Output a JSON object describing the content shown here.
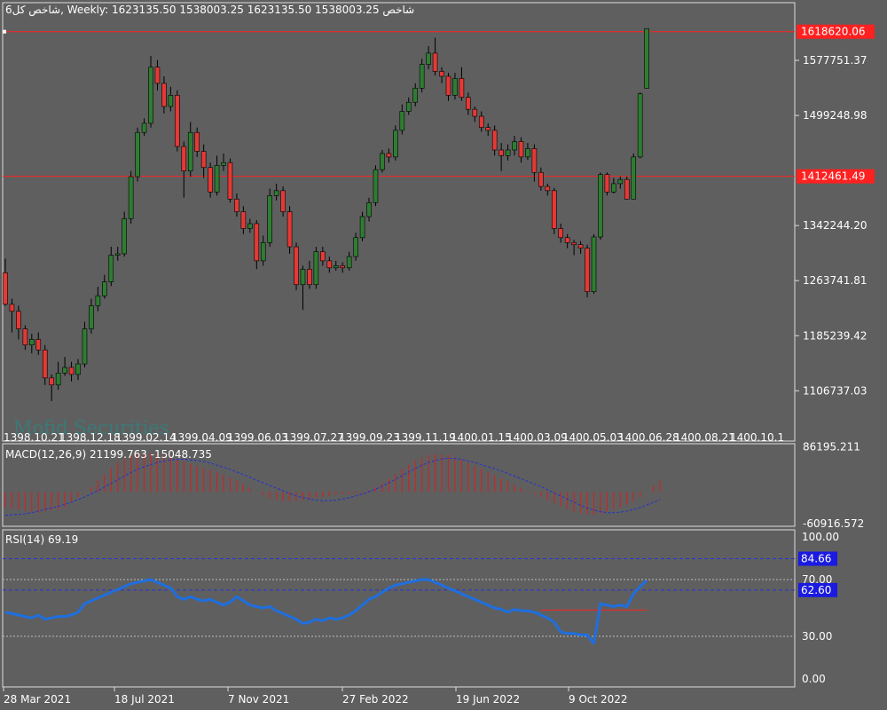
{
  "header": {
    "main": "6شاخص کل, Weekly:  1623135.50 1538003.25 1623135.50 1538003.25  شاخص",
    "macd": "MACD(12,26,9) 21199.763 -15048.735",
    "rsi": "RSI(14) 69.19"
  },
  "watermark": "Mofid Securities",
  "colors": {
    "bg": "#5f5f5f",
    "bull": "#2e7d32",
    "bear": "#e53935",
    "grid": "#9a9a9a",
    "hline": "#ff2020",
    "rsi": "#1e6fe0",
    "signal": "#2233cc",
    "label_bg": "#1a1ae0"
  },
  "chart_data": [
    {
      "type": "candlestick",
      "title": "شاخص کل",
      "timeframe": "Weekly",
      "y_ticks": [
        "1577751.37",
        "1499248.98",
        "1342244.20",
        "1263741.81",
        "1185239.42",
        "1106737.03"
      ],
      "ylim": [
        1035000,
        1660000
      ],
      "price_labels": [
        "1618620.06",
        "1412461.49"
      ],
      "hlines": [
        1618620.06,
        1412461.49
      ],
      "top_date_labels": [
        "1398.10.21",
        "1398.12.18",
        "1399.02.14",
        "1399.04.09",
        "1399.06.03",
        "1399.07.27",
        "1399.09.23",
        "1399.11.19",
        "1400.01.15",
        "1400.03.09",
        "1400.05.03",
        "1400.06.28",
        "1400.08.21",
        "1400.10.1"
      ],
      "x_labels": [
        "28 Mar 2021",
        "18 Jul 2021",
        "7 Nov 2021",
        "27 Feb 2022",
        "19 Jun 2022",
        "9 Oct 2022"
      ],
      "candles": [
        [
          1275000,
          1230000,
          1295000,
          1228000
        ],
        [
          1230000,
          1220000,
          1238000,
          1190000
        ],
        [
          1220000,
          1195000,
          1228000,
          1180000
        ],
        [
          1195000,
          1172000,
          1200000,
          1165000
        ],
        [
          1172000,
          1180000,
          1188000,
          1160000
        ],
        [
          1180000,
          1165000,
          1190000,
          1158000
        ],
        [
          1165000,
          1125000,
          1172000,
          1115000
        ],
        [
          1125000,
          1115000,
          1130000,
          1092000
        ],
        [
          1115000,
          1132000,
          1148000,
          1108000
        ],
        [
          1132000,
          1140000,
          1155000,
          1128000
        ],
        [
          1140000,
          1130000,
          1148000,
          1120000
        ],
        [
          1130000,
          1145000,
          1152000,
          1122000
        ],
        [
          1145000,
          1195000,
          1205000,
          1140000
        ],
        [
          1195000,
          1228000,
          1238000,
          1188000
        ],
        [
          1228000,
          1242000,
          1255000,
          1220000
        ],
        [
          1242000,
          1262000,
          1272000,
          1238000
        ],
        [
          1262000,
          1300000,
          1312000,
          1256000
        ],
        [
          1300000,
          1302000,
          1312000,
          1292000
        ],
        [
          1302000,
          1352000,
          1362000,
          1298000
        ],
        [
          1352000,
          1412000,
          1420000,
          1345000
        ],
        [
          1412000,
          1475000,
          1482000,
          1405000
        ],
        [
          1475000,
          1488000,
          1495000,
          1470000
        ],
        [
          1488000,
          1568000,
          1584000,
          1482000
        ],
        [
          1568000,
          1545000,
          1578000,
          1535000
        ],
        [
          1545000,
          1512000,
          1555000,
          1502000
        ],
        [
          1512000,
          1528000,
          1540000,
          1505000
        ],
        [
          1528000,
          1455000,
          1535000,
          1448000
        ],
        [
          1455000,
          1420000,
          1462000,
          1382000
        ],
        [
          1420000,
          1475000,
          1490000,
          1412000
        ],
        [
          1475000,
          1448000,
          1482000,
          1440000
        ],
        [
          1448000,
          1425000,
          1458000,
          1410000
        ],
        [
          1425000,
          1390000,
          1432000,
          1382000
        ],
        [
          1390000,
          1428000,
          1442000,
          1385000
        ],
        [
          1428000,
          1432000,
          1445000,
          1420000
        ],
        [
          1432000,
          1380000,
          1438000,
          1375000
        ],
        [
          1380000,
          1362000,
          1388000,
          1355000
        ],
        [
          1362000,
          1338000,
          1370000,
          1330000
        ],
        [
          1338000,
          1345000,
          1352000,
          1332000
        ],
        [
          1345000,
          1292000,
          1350000,
          1280000
        ],
        [
          1292000,
          1318000,
          1328000,
          1285000
        ],
        [
          1318000,
          1385000,
          1395000,
          1312000
        ],
        [
          1385000,
          1392000,
          1402000,
          1378000
        ],
        [
          1392000,
          1362000,
          1398000,
          1355000
        ],
        [
          1362000,
          1312000,
          1370000,
          1302000
        ],
        [
          1312000,
          1258000,
          1318000,
          1250000
        ],
        [
          1258000,
          1280000,
          1285000,
          1222000
        ],
        [
          1280000,
          1258000,
          1292000,
          1252000
        ],
        [
          1258000,
          1305000,
          1312000,
          1252000
        ],
        [
          1305000,
          1292000,
          1312000,
          1285000
        ],
        [
          1292000,
          1282000,
          1298000,
          1275000
        ],
        [
          1282000,
          1285000,
          1292000,
          1278000
        ],
        [
          1285000,
          1282000,
          1290000,
          1275000
        ],
        [
          1282000,
          1298000,
          1305000,
          1278000
        ],
        [
          1298000,
          1325000,
          1332000,
          1292000
        ],
        [
          1325000,
          1355000,
          1362000,
          1320000
        ],
        [
          1355000,
          1375000,
          1382000,
          1348000
        ],
        [
          1375000,
          1422000,
          1428000,
          1370000
        ],
        [
          1422000,
          1445000,
          1450000,
          1418000
        ],
        [
          1445000,
          1440000,
          1452000,
          1432000
        ],
        [
          1440000,
          1478000,
          1485000,
          1435000
        ],
        [
          1478000,
          1505000,
          1515000,
          1472000
        ],
        [
          1505000,
          1518000,
          1525000,
          1500000
        ],
        [
          1518000,
          1538000,
          1545000,
          1512000
        ],
        [
          1538000,
          1572000,
          1580000,
          1532000
        ],
        [
          1572000,
          1588000,
          1598000,
          1565000
        ],
        [
          1588000,
          1562000,
          1610000,
          1556000
        ],
        [
          1562000,
          1555000,
          1568000,
          1545000
        ],
        [
          1555000,
          1528000,
          1560000,
          1520000
        ],
        [
          1528000,
          1552000,
          1560000,
          1522000
        ],
        [
          1552000,
          1525000,
          1568000,
          1520000
        ],
        [
          1525000,
          1508000,
          1532000,
          1500000
        ],
        [
          1508000,
          1498000,
          1512000,
          1490000
        ],
        [
          1498000,
          1482000,
          1505000,
          1476000
        ],
        [
          1482000,
          1478000,
          1488000,
          1470000
        ],
        [
          1478000,
          1450000,
          1485000,
          1442000
        ],
        [
          1450000,
          1442000,
          1460000,
          1420000
        ],
        [
          1442000,
          1450000,
          1458000,
          1435000
        ],
        [
          1450000,
          1462000,
          1470000,
          1442000
        ],
        [
          1462000,
          1440000,
          1468000,
          1432000
        ],
        [
          1440000,
          1452000,
          1460000,
          1436000
        ],
        [
          1452000,
          1418000,
          1458000,
          1405000
        ],
        [
          1418000,
          1398000,
          1425000,
          1392000
        ],
        [
          1398000,
          1392000,
          1402000,
          1385000
        ],
        [
          1392000,
          1338000,
          1396000,
          1330000
        ],
        [
          1338000,
          1325000,
          1345000,
          1318000
        ],
        [
          1325000,
          1318000,
          1330000,
          1310000
        ],
        [
          1318000,
          1315000,
          1322000,
          1300000
        ],
        [
          1315000,
          1310000,
          1320000,
          1302000
        ],
        [
          1310000,
          1248000,
          1315000,
          1240000
        ],
        [
          1248000,
          1326000,
          1330000,
          1245000
        ],
        [
          1326000,
          1415000,
          1418000,
          1322000
        ],
        [
          1415000,
          1390000,
          1418000,
          1385000
        ],
        [
          1390000,
          1402000,
          1410000,
          1388000
        ],
        [
          1402000,
          1408000,
          1412000,
          1395000
        ],
        [
          1408000,
          1380000,
          1412000,
          1380000
        ],
        [
          1380000,
          1440000,
          1445000,
          1380000
        ],
        [
          1440000,
          1530000,
          1532000,
          1438000
        ],
        [
          1538000,
          1623000,
          1623000,
          1538000
        ]
      ]
    },
    {
      "type": "bar",
      "name": "MACD(12,26,9)",
      "values_shown": [
        21199.763,
        -15048.735
      ],
      "y_ticks": [
        "86195.211",
        "-60916.572"
      ],
      "ylim": [
        -66000,
        92000
      ],
      "histogram": [
        -30000,
        -32000,
        -34000,
        -36000,
        -38000,
        -40000,
        -38000,
        -36000,
        -34000,
        -30000,
        -20000,
        -10000,
        0,
        10000,
        22000,
        34000,
        46000,
        56000,
        64000,
        70000,
        72000,
        74000,
        74000,
        72000,
        70000,
        66000,
        62000,
        58000,
        54000,
        50000,
        46000,
        42000,
        38000,
        33000,
        28000,
        22000,
        15000,
        8000,
        1000,
        -6000,
        -12000,
        -16000,
        -18000,
        -18000,
        -18000,
        -16000,
        -14000,
        -12000,
        -10000,
        -8000,
        -6000,
        -4000,
        -4000,
        -4000,
        -2000,
        2000,
        8000,
        16000,
        25000,
        34000,
        44000,
        52000,
        60000,
        66000,
        70000,
        72000,
        72000,
        70000,
        66000,
        62000,
        56000,
        50000,
        44000,
        38000,
        32000,
        26000,
        20000,
        14000,
        8000,
        2000,
        -4000,
        -10000,
        -16000,
        -22000,
        -28000,
        -33000,
        -38000,
        -41000,
        -43000,
        -44000,
        -42000,
        -38000,
        -34000,
        -30000,
        -25000,
        -18000,
        -10000,
        0,
        12000,
        21199.763
      ],
      "signal": [
        -45000,
        -44000,
        -43000,
        -42000,
        -40000,
        -37000,
        -34000,
        -31000,
        -28000,
        -24000,
        -20000,
        -15000,
        -10000,
        -4000,
        2000,
        9000,
        16000,
        23000,
        30000,
        37000,
        43000,
        48000,
        52000,
        56000,
        59000,
        61000,
        62000,
        62000,
        61000,
        60000,
        58000,
        55000,
        51000,
        47000,
        43000,
        38000,
        33000,
        28000,
        22000,
        17000,
        12000,
        7000,
        2000,
        -3000,
        -8000,
        -11000,
        -14000,
        -16000,
        -17000,
        -17000,
        -16000,
        -14000,
        -11000,
        -8000,
        -4000,
        0,
        5000,
        11000,
        17000,
        24000,
        31000,
        38000,
        45000,
        51000,
        56000,
        60000,
        63000,
        64000,
        64000,
        62000,
        59000,
        56000,
        52000,
        48000,
        44000,
        40000,
        35000,
        30000,
        25000,
        20000,
        15000,
        10000,
        4000,
        -2000,
        -8000,
        -14000,
        -20000,
        -26000,
        -31000,
        -35000,
        -38000,
        -40000,
        -40000,
        -39000,
        -37000,
        -34000,
        -30000,
        -25000,
        -20000,
        -15048.735
      ]
    },
    {
      "type": "line",
      "name": "RSI(14)",
      "value_shown": 69.19,
      "y_ticks": [
        "100.00",
        "70.00",
        "30.00",
        "0.00"
      ],
      "ylim": [
        0,
        100
      ],
      "levels": [
        84.66,
        62.6
      ],
      "level_labels": [
        "84.66",
        "62.60"
      ],
      "values": [
        47,
        46,
        45,
        44,
        43,
        45,
        42,
        43,
        44,
        44,
        45,
        47,
        53,
        55,
        57,
        59,
        61,
        63,
        65,
        67,
        68,
        69,
        70,
        68,
        66,
        64,
        58,
        56,
        58,
        56,
        55,
        56,
        54,
        52,
        54,
        58,
        55,
        52,
        51,
        50,
        51,
        48,
        46,
        44,
        42,
        39,
        40,
        42,
        41,
        43,
        42,
        43,
        45,
        48,
        52,
        56,
        58,
        61,
        64,
        66,
        67,
        68,
        69,
        70,
        70,
        68,
        66,
        64,
        62,
        60,
        58,
        56,
        54,
        52,
        50,
        49,
        47,
        49,
        48,
        48,
        47,
        45,
        43,
        40,
        33,
        32,
        32,
        31,
        31,
        25,
        53,
        52,
        51,
        52,
        51,
        60,
        65,
        69.19
      ],
      "ref_line": 48.5
    }
  ]
}
